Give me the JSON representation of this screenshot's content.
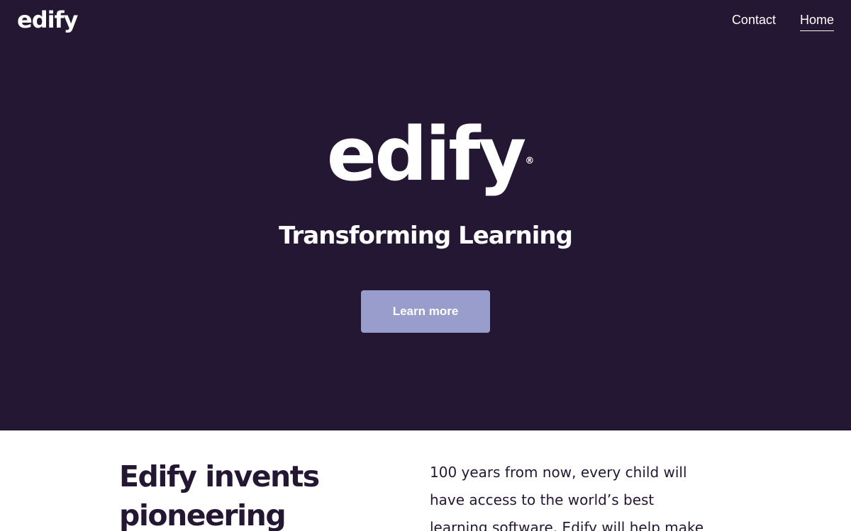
{
  "header": {
    "brand": "edify",
    "nav": [
      {
        "label": "Contact",
        "active": false
      },
      {
        "label": "Home",
        "active": true
      }
    ]
  },
  "hero": {
    "logo_text": "edify",
    "registered_mark": "®",
    "tagline": "Transforming Learning",
    "cta_label": "Learn more"
  },
  "intro": {
    "heading": "Edify invents pioneering",
    "body": "100 years from now, every child will have access to the world’s best learning software. Edify will help make"
  },
  "colors": {
    "hero_background": "#241733",
    "button_background": "#989dcc",
    "text_dark": "#241733"
  }
}
